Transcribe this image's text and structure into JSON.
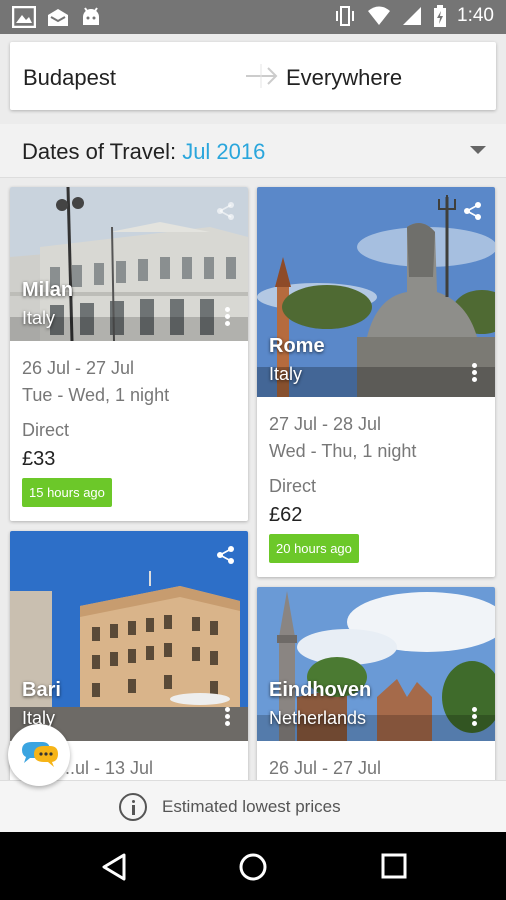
{
  "status_bar": {
    "time": "1:40"
  },
  "route": {
    "from": "Budapest",
    "to": "Everywhere"
  },
  "dates": {
    "label": "Dates of Travel: ",
    "value": "Jul 2016"
  },
  "cards": [
    {
      "city": "Milan",
      "country": "Italy",
      "dates": "26 Jul - 27 Jul",
      "days": "Tue - Wed, 1 night",
      "stops": "Direct",
      "price": "£33",
      "badge": "15 hours ago"
    },
    {
      "city": "Rome",
      "country": "Italy",
      "dates": "27 Jul - 28 Jul",
      "days": "Wed - Thu, 1 night",
      "stops": "Direct",
      "price": "£62",
      "badge": "20 hours ago"
    },
    {
      "city": "Bari",
      "country": "Italy",
      "dates": "...ul - 13 Jul"
    },
    {
      "city": "Eindhoven",
      "country": "Netherlands",
      "dates": "26 Jul - 27 Jul"
    }
  ],
  "footer": {
    "text": "Estimated lowest prices"
  },
  "colors": {
    "accent": "#2aa6dc",
    "badge": "#6cc829"
  }
}
